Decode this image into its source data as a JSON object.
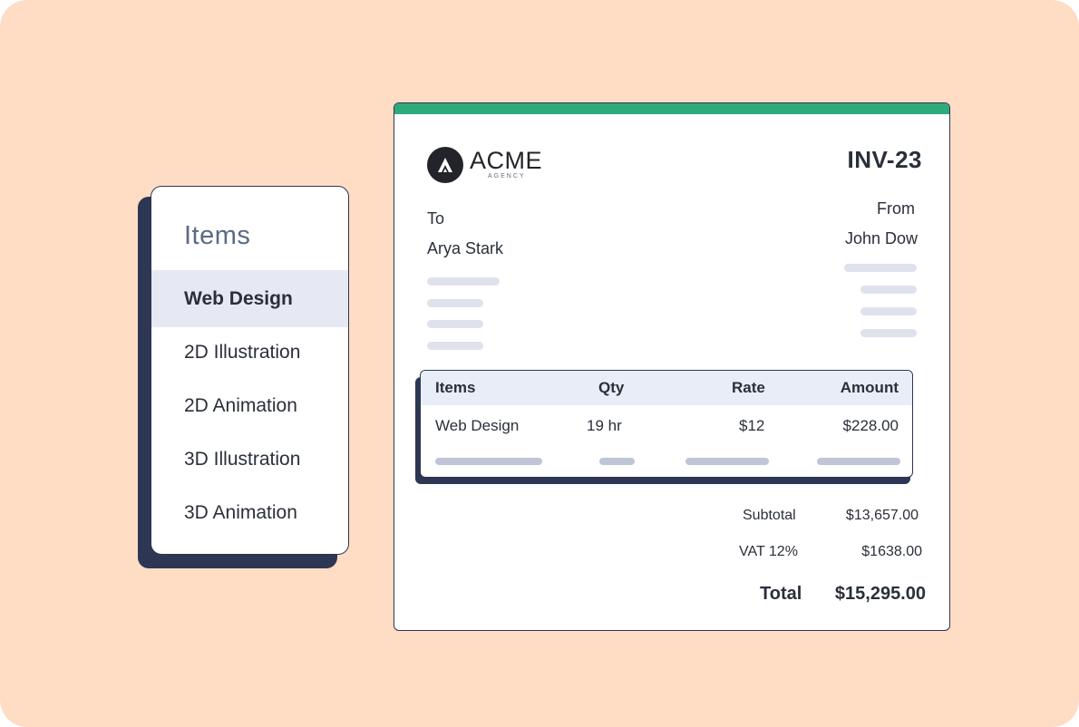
{
  "items_panel": {
    "title": "Items",
    "items": [
      {
        "label": "Web Design",
        "selected": true
      },
      {
        "label": "2D Illustration",
        "selected": false
      },
      {
        "label": "2D Animation",
        "selected": false
      },
      {
        "label": "3D Illustration",
        "selected": false
      },
      {
        "label": "3D Animation",
        "selected": false
      }
    ]
  },
  "invoice": {
    "logo": {
      "word": "ACME",
      "sub": "AGENCY",
      "icon": "acme-logo-icon"
    },
    "number": "INV-23",
    "to_label": "To",
    "to_name": "Arya Stark",
    "from_label": "From",
    "from_name": "John Dow",
    "table": {
      "headers": {
        "items": "Items",
        "qty": "Qty",
        "rate": "Rate",
        "amount": "Amount"
      },
      "row": {
        "item": "Web Design",
        "qty": "19 hr",
        "rate": "$12",
        "amount": "$228.00"
      }
    },
    "totals": {
      "subtotal_label": "Subtotal",
      "subtotal_value": "$13,657.00",
      "vat_label": "VAT 12%",
      "vat_value": "$1638.00",
      "total_label": "Total",
      "total_value": "$15,295.00"
    }
  },
  "colors": {
    "background": "#ffdcc4",
    "accent_bar": "#2faa7a",
    "navy": "#2d3652",
    "selected_row": "#e6e9f4"
  }
}
